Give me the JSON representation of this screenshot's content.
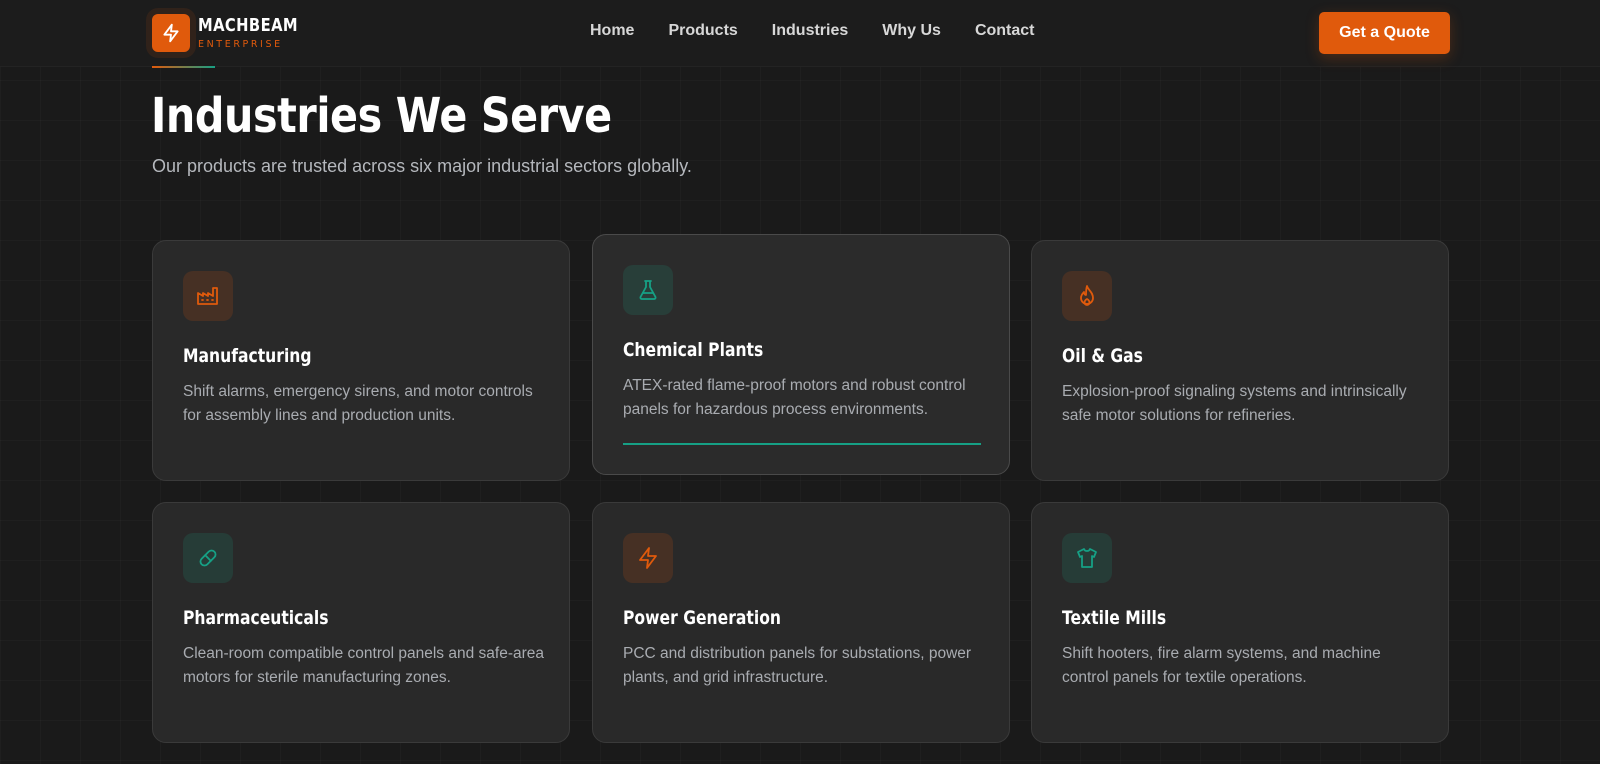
{
  "brand": {
    "name": "MACHBEAM",
    "tagline": "ENTERPRISE"
  },
  "nav": {
    "links": [
      "Home",
      "Products",
      "Industries",
      "Why Us",
      "Contact"
    ],
    "cta": "Get a Quote"
  },
  "section": {
    "title": "Industries We Serve",
    "subtitle": "Our products are trusted across six major industrial sectors globally."
  },
  "colors": {
    "accent_orange": "#e05a0c",
    "accent_teal": "#16a085",
    "background": "#1a1a1a"
  },
  "industries": [
    {
      "title": "Manufacturing",
      "icon": "factory-icon",
      "color": "orange",
      "description": "Shift alarms, emergency sirens, and motor controls for assembly lines and production units."
    },
    {
      "title": "Chemical Plants",
      "icon": "flask-icon",
      "color": "teal",
      "description": "ATEX-rated flame-proof motors and robust control panels for hazardous process environments."
    },
    {
      "title": "Oil & Gas",
      "icon": "flame-icon",
      "color": "orange",
      "description": "Explosion-proof signaling systems and intrinsically safe motor solutions for refineries."
    },
    {
      "title": "Pharmaceuticals",
      "icon": "pill-icon",
      "color": "teal",
      "description": "Clean-room compatible control panels and safe-area motors for sterile manufacturing zones."
    },
    {
      "title": "Power Generation",
      "icon": "lightning-icon",
      "color": "orange",
      "description": "PCC and distribution panels for substations, power plants, and grid infrastructure."
    },
    {
      "title": "Textile Mills",
      "icon": "shirt-icon",
      "color": "teal",
      "description": "Shift hooters, fire alarm systems, and machine control panels for textile operations."
    }
  ]
}
